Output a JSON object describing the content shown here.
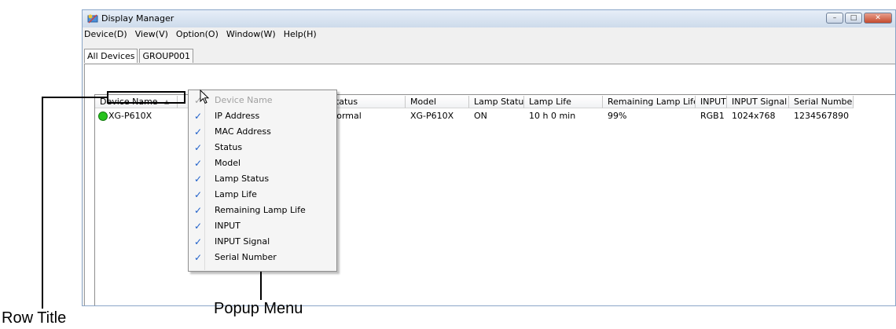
{
  "window": {
    "title": "Display Manager",
    "buttons": {
      "minimize": "–",
      "maximize": "□",
      "close": "✕"
    }
  },
  "menu": [
    "Device(D)",
    "View(V)",
    "Option(O)",
    "Window(W)",
    "Help(H)"
  ],
  "tabs": [
    {
      "label": "All Devices",
      "active": true
    },
    {
      "label": "GROUP001",
      "active": false
    }
  ],
  "table": {
    "columns": [
      "Device Name",
      "",
      "",
      "Status",
      "Model",
      "Lamp Status",
      "Lamp Life",
      "Remaining Lamp Life",
      "INPUT",
      "INPUT Signal",
      "Serial Number"
    ],
    "sort_indicator": "▲",
    "rows": [
      {
        "device_name": "XG-P610X",
        "status": "Normal",
        "model": "XG-P610X",
        "lamp_status": "ON",
        "lamp_life": "10 h 0 min",
        "remaining_lamp_life": "99%",
        "input": "RGB1",
        "input_signal": "1024x768",
        "serial_number": "1234567890",
        "status_color": "#27c21e"
      }
    ]
  },
  "popup_menu": {
    "check_mark": "✓",
    "items": [
      {
        "label": "Device Name",
        "checked": true,
        "disabled": true
      },
      {
        "label": "IP Address",
        "checked": true,
        "disabled": false
      },
      {
        "label": "MAC Address",
        "checked": true,
        "disabled": false
      },
      {
        "label": "Status",
        "checked": true,
        "disabled": false
      },
      {
        "label": "Model",
        "checked": true,
        "disabled": false
      },
      {
        "label": "Lamp Status",
        "checked": true,
        "disabled": false
      },
      {
        "label": "Lamp Life",
        "checked": true,
        "disabled": false
      },
      {
        "label": "Remaining Lamp Life",
        "checked": true,
        "disabled": false
      },
      {
        "label": "INPUT",
        "checked": true,
        "disabled": false
      },
      {
        "label": "INPUT Signal",
        "checked": true,
        "disabled": false
      },
      {
        "label": "Serial Number",
        "checked": true,
        "disabled": false
      }
    ]
  },
  "callouts": {
    "row_title": "Row Title",
    "popup_menu": "Popup Menu"
  }
}
